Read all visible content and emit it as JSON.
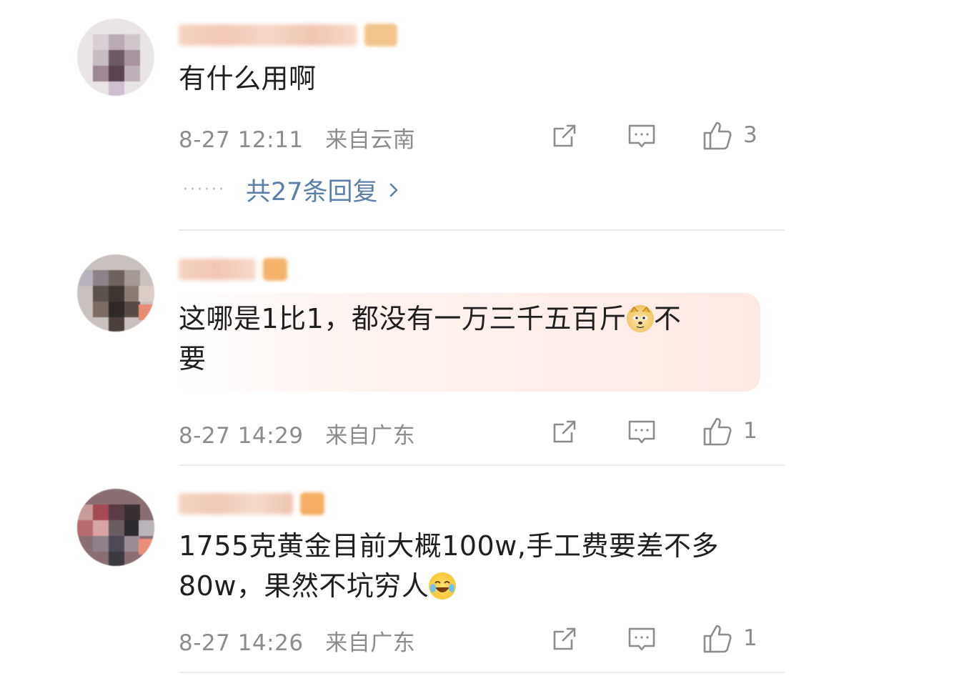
{
  "comments": [
    {
      "content": "有什么用啊",
      "time": "8-27 12:11",
      "location": "来自云南",
      "like_count": "3",
      "replies_label": "共27条回复",
      "replies_dots": "······"
    },
    {
      "content_part1": "这哪是1比1，都没有一万三千五百斤",
      "content_part2": "不",
      "content_part3": "要",
      "time": "8-27 14:29",
      "location": "来自广东",
      "like_count": "1"
    },
    {
      "content_line1": "1755克黄金目前大概100w,手工费要差不多",
      "content_line2": "80w，果然不坑穷人",
      "time": "8-27 14:26",
      "location": "来自广东",
      "like_count": "1"
    }
  ],
  "icons": {
    "share": "share-icon",
    "comment": "comment-icon",
    "like": "thumbs-up-icon",
    "chevron": "chevron-right-icon",
    "doge": "doge-emoji",
    "laugh_cry": "laugh-cry-emoji"
  },
  "colors": {
    "meta_text": "#8c8c8c",
    "reply_link": "#5c7fa9",
    "divider": "#ececec",
    "highlight": "#fde9e4"
  }
}
